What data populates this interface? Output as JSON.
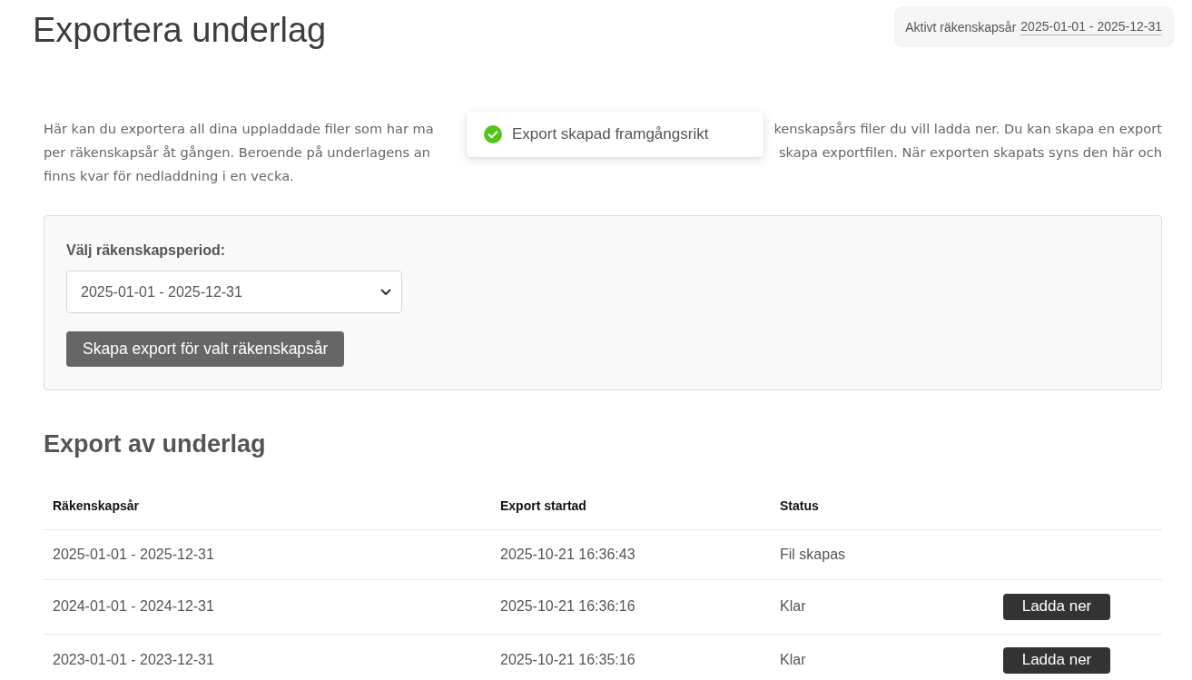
{
  "page": {
    "title": "Exportera underlag"
  },
  "active_year": {
    "label": "Aktivt räkenskapsår",
    "value": "2025-01-01 - 2025-12-31"
  },
  "intro": {
    "lines": [
      {
        "parts": [
          "Här kan du exportera all dina uppladdade filer som har ma",
          "kenskapsårs filer du vill ladda ner. Du kan skapa en export"
        ]
      },
      {
        "parts": [
          "per räkenskapsår åt gången. Beroende på underlagens an",
          "skapa exportfilen. När exporten skapats syns den här och"
        ]
      },
      {
        "parts": [
          "finns kvar för nedladdning i en vecka."
        ]
      }
    ]
  },
  "toast": {
    "kind": "success",
    "message": "Export skapad framgångsrikt"
  },
  "export_form": {
    "label": "Välj räkenskapsperiod:",
    "period_select": {
      "value": "2025-01-01 - 2025-12-31"
    },
    "submit_button": "Skapa export för valt räkenskapsår"
  },
  "exports": {
    "title": "Export av underlag",
    "columns": [
      "Räkenskapsår",
      "Export startad",
      "Status"
    ],
    "rows": [
      {
        "fiscal_year": "2025-01-01 - 2025-12-31",
        "started": "2025-10-21 16:36:43",
        "status": "Fil skapas"
      },
      {
        "fiscal_year": "2024-01-01 - 2024-12-31",
        "started": "2025-10-21 16:36:16",
        "status": "Klar",
        "download_button": "Ladda ner"
      },
      {
        "fiscal_year": "2023-01-01 - 2023-12-31",
        "started": "2025-10-21 16:35:16",
        "status": "Klar",
        "download_button": "Ladda ner"
      }
    ]
  }
}
